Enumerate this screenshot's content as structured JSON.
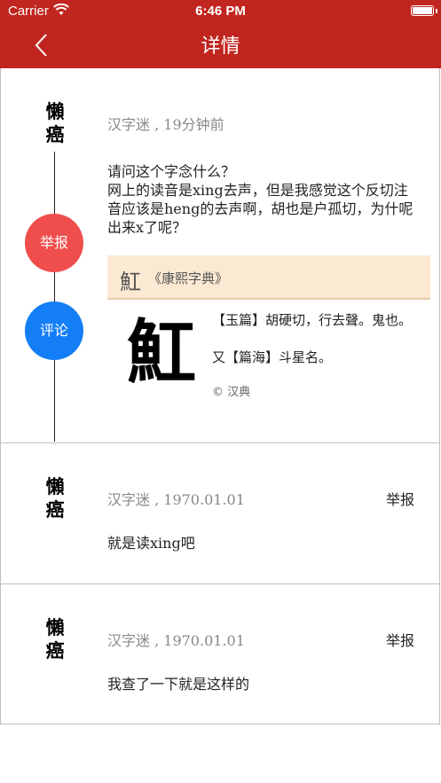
{
  "status_bar": {
    "carrier": "Carrier",
    "time": "6:46 PM"
  },
  "nav": {
    "title": "详情",
    "back_icon": "chevron-left-icon"
  },
  "colors": {
    "nav_bg": "#c0261f",
    "report_circle": "#f04d4d",
    "comment_circle": "#147ef6"
  },
  "post": {
    "avatar_text": "懶癌",
    "meta": "汉字迷 , 19分钟前",
    "content_lines": [
      "请问这个字念什么？",
      "网上的读音是xing去声，但是我感觉这个反切注",
      "音应该是heng的去声啊，胡也是户孤切，为什呢",
      "出来x了呢？"
    ],
    "actions": {
      "report": "举报",
      "comment": "评论"
    },
    "dictionary": {
      "head_char": "魟",
      "book": "《康熙字典》",
      "big_char": "魟",
      "line1": "【玉篇】胡硬切，行去聲。鬼也。",
      "line2": "又【篇海】斗星名。",
      "source": "© 汉典"
    }
  },
  "replies": [
    {
      "avatar_text": "懶癌",
      "meta": "汉字迷 , 1970.01.01",
      "report": "举报",
      "content": "就是读xing吧"
    },
    {
      "avatar_text": "懶癌",
      "meta": "汉字迷 , 1970.01.01",
      "report": "举报",
      "content": "我查了一下就是这样的"
    }
  ]
}
